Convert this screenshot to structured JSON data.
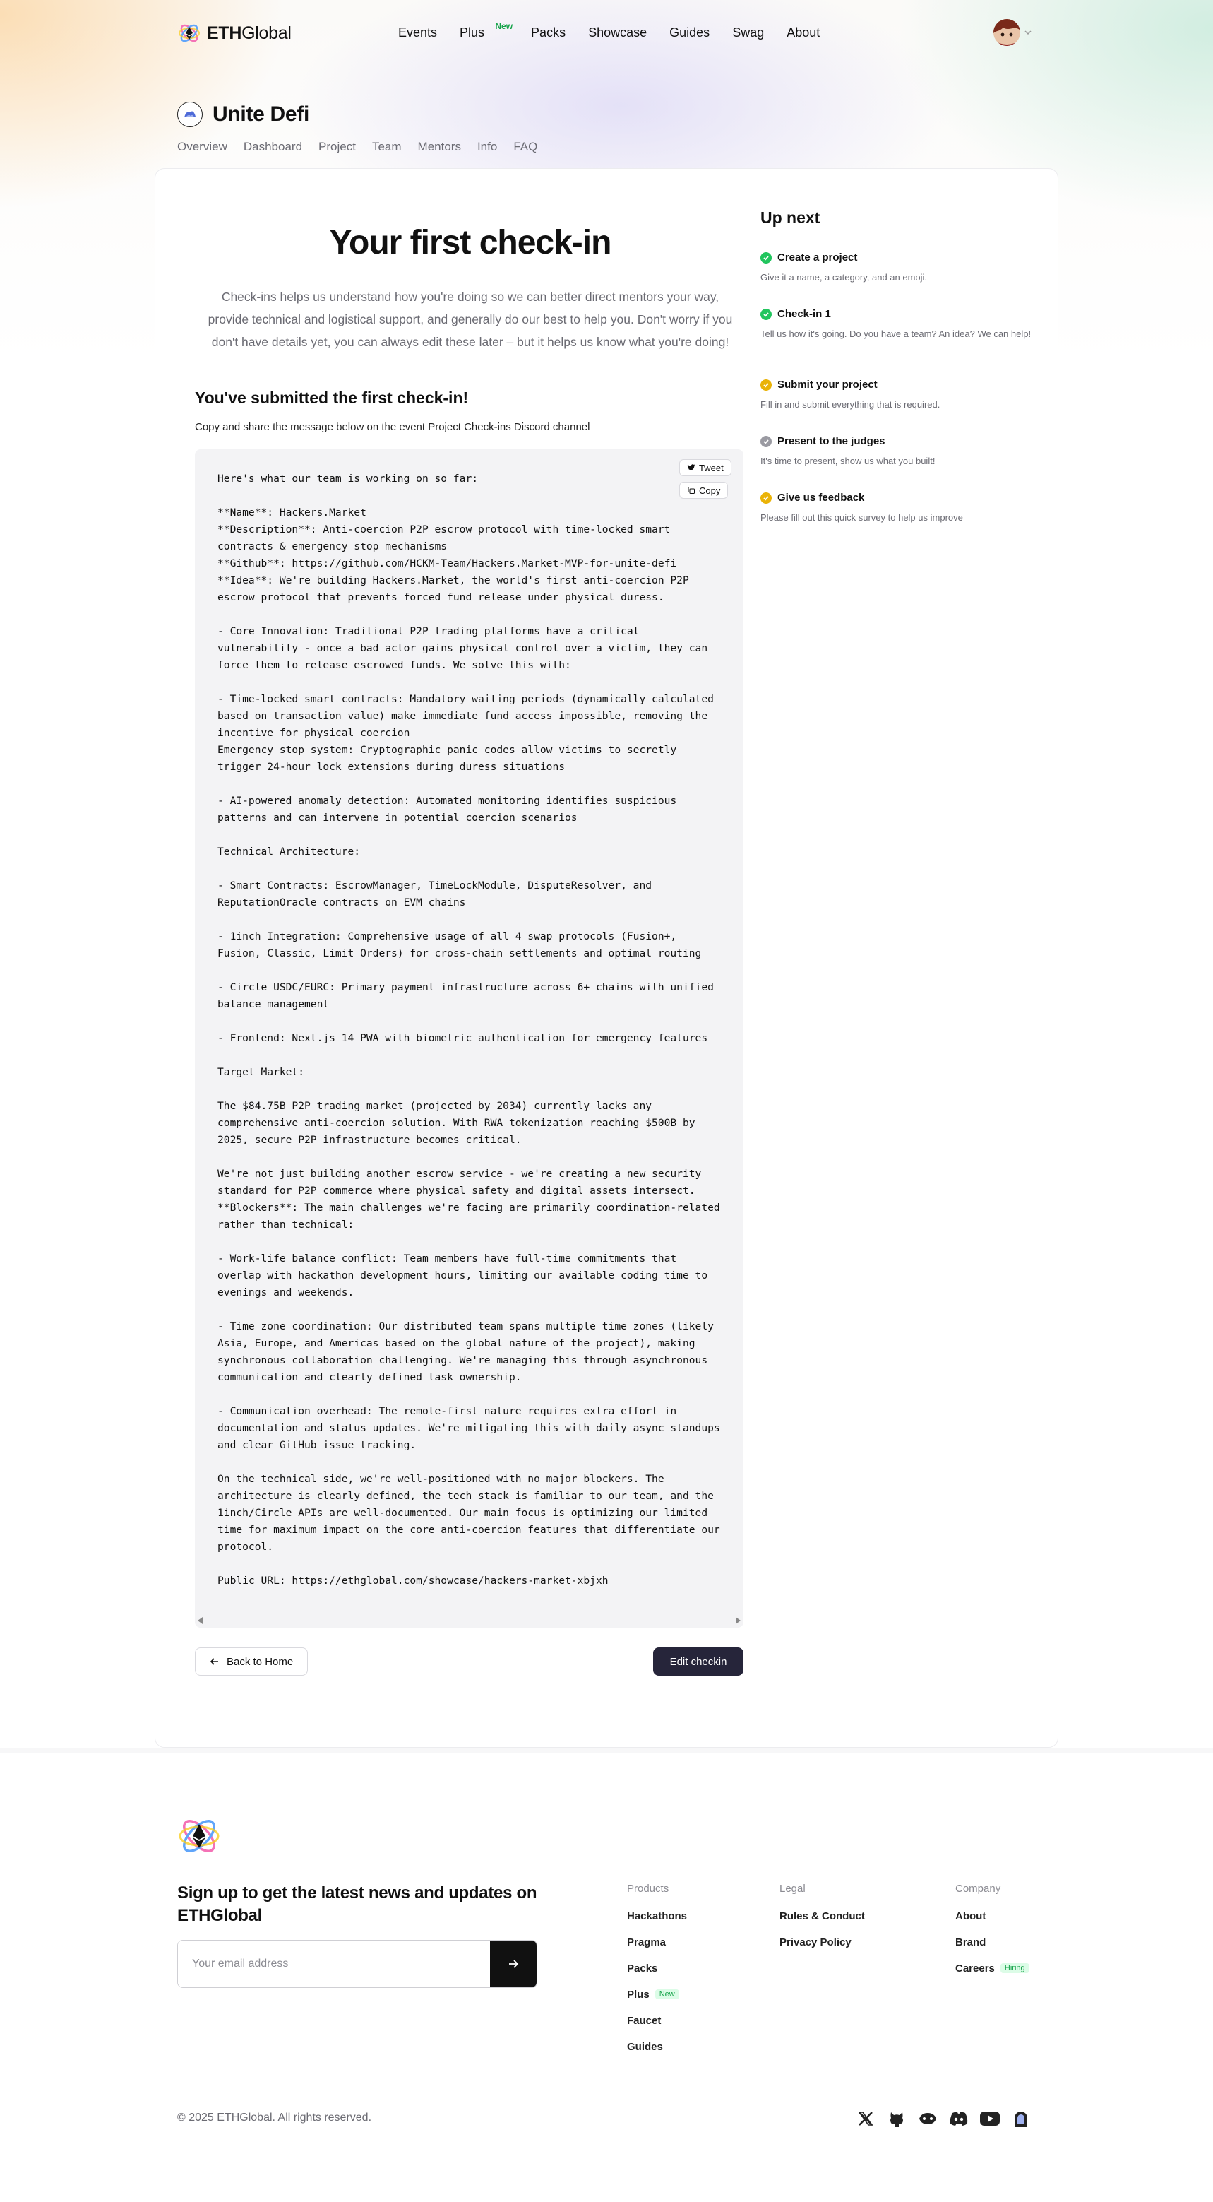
{
  "header": {
    "logo_bold": "ETH",
    "logo_rest": "Global",
    "nav": [
      "Events",
      "Plus",
      "Packs",
      "Showcase",
      "Guides",
      "Swag",
      "About"
    ],
    "plus_badge": "New"
  },
  "event": {
    "title": "Unite Defi",
    "tabs": [
      "Overview",
      "Dashboard",
      "Project",
      "Team",
      "Mentors",
      "Info",
      "FAQ"
    ]
  },
  "main": {
    "title": "Your first check-in",
    "intro": "Check-ins helps us understand how you're doing so we can better direct mentors your way, provide technical and logistical support, and generally do our best to help you. Don't worry if you don't have details yet, you can always edit these later – but it helps us know what you're doing!",
    "submitted_title": "You've submitted the first check-in!",
    "submitted_desc": "Copy and share the message below on the event Project Check-ins Discord channel",
    "tweet_label": "Tweet",
    "copy_label": "Copy",
    "message": "Here's what our team is working on so far:\n\n**Name**: Hackers.Market\n**Description**: Anti-coercion P2P escrow protocol with time-locked smart\ncontracts & emergency stop mechanisms\n**Github**: https://github.com/HCKM-Team/Hackers.Market-MVP-for-unite-defi\n**Idea**: We're building Hackers.Market, the world's first anti-coercion P2P\nescrow protocol that prevents forced fund release under physical duress.\n\n- Core Innovation: Traditional P2P trading platforms have a critical\nvulnerability - once a bad actor gains physical control over a victim, they can\nforce them to release escrowed funds. We solve this with:\n\n- Time-locked smart contracts: Mandatory waiting periods (dynamically calculated\nbased on transaction value) make immediate fund access impossible, removing the\nincentive for physical coercion\nEmergency stop system: Cryptographic panic codes allow victims to secretly\ntrigger 24-hour lock extensions during duress situations\n\n- AI-powered anomaly detection: Automated monitoring identifies suspicious\npatterns and can intervene in potential coercion scenarios\n\nTechnical Architecture:\n\n- Smart Contracts: EscrowManager, TimeLockModule, DisputeResolver, and\nReputationOracle contracts on EVM chains\n\n- 1inch Integration: Comprehensive usage of all 4 swap protocols (Fusion+,\nFusion, Classic, Limit Orders) for cross-chain settlements and optimal routing\n\n- Circle USDC/EURC: Primary payment infrastructure across 6+ chains with unified\nbalance management\n\n- Frontend: Next.js 14 PWA with biometric authentication for emergency features\n\nTarget Market:\n\nThe $84.75B P2P trading market (projected by 2034) currently lacks any\ncomprehensive anti-coercion solution. With RWA tokenization reaching $500B by\n2025, secure P2P infrastructure becomes critical.\n\nWe're not just building another escrow service - we're creating a new security\nstandard for P2P commerce where physical safety and digital assets intersect.\n**Blockers**: The main challenges we're facing are primarily coordination-related\nrather than technical:\n\n- Work-life balance conflict: Team members have full-time commitments that\noverlap with hackathon development hours, limiting our available coding time to\nevenings and weekends.\n\n- Time zone coordination: Our distributed team spans multiple time zones (likely\nAsia, Europe, and Americas based on the global nature of the project), making\nsynchronous collaboration challenging. We're managing this through asynchronous\ncommunication and clearly defined task ownership.\n\n- Communication overhead: The remote-first nature requires extra effort in\ndocumentation and status updates. We're mitigating this with daily async standups\nand clear GitHub issue tracking.\n\nOn the technical side, we're well-positioned with no major blockers. The\narchitecture is clearly defined, the tech stack is familiar to our team, and the\n1inch/Circle APIs are well-documented. Our main focus is optimizing our limited\ntime for maximum impact on the core anti-coercion features that differentiate our\nprotocol.\n\nPublic URL: https://ethglobal.com/showcase/hackers-market-xbjxh",
    "back_label": "Back to Home",
    "edit_label": "Edit checkin"
  },
  "up_next": {
    "title": "Up next",
    "steps": [
      {
        "title": "Create a project",
        "desc": "Give it a name, a category, and an emoji.",
        "status": "done"
      },
      {
        "title": "Check-in 1",
        "desc": "Tell us how it's going. Do you have a team? An idea? We can help!",
        "status": "done"
      },
      {
        "title": "Submit your project",
        "desc": "Fill in and submit everything that is required.",
        "status": "pending"
      },
      {
        "title": "Present to the judges",
        "desc": "It's time to present, show us what you built!",
        "status": "locked"
      },
      {
        "title": "Give us feedback",
        "desc": "Please fill out this quick survey to help us improve",
        "status": "pending"
      }
    ]
  },
  "footer": {
    "signup": "Sign up to get the latest news and updates on ETHGlobal",
    "email_placeholder": "Your email address",
    "products": {
      "title": "Products",
      "links": [
        "Hackathons",
        "Pragma",
        "Packs",
        "Plus",
        "Faucet",
        "Guides"
      ],
      "plus_badge": "New"
    },
    "legal": {
      "title": "Legal",
      "links": [
        "Rules & Conduct",
        "Privacy Policy"
      ]
    },
    "company": {
      "title": "Company",
      "links": [
        "About",
        "Brand",
        "Careers"
      ],
      "careers_badge": "Hiring"
    },
    "copyright": "© 2025 ETHGlobal. All rights reserved.",
    "social_icons": [
      "x-icon",
      "github-icon",
      "farcaster-icon",
      "discord-icon",
      "youtube-icon",
      "mirror-icon"
    ]
  },
  "colors": {
    "primary_dark": "#26253a",
    "success": "#22c55e",
    "warning": "#eab308",
    "muted": "#8b8b92",
    "badge_green": "#16a34a"
  }
}
